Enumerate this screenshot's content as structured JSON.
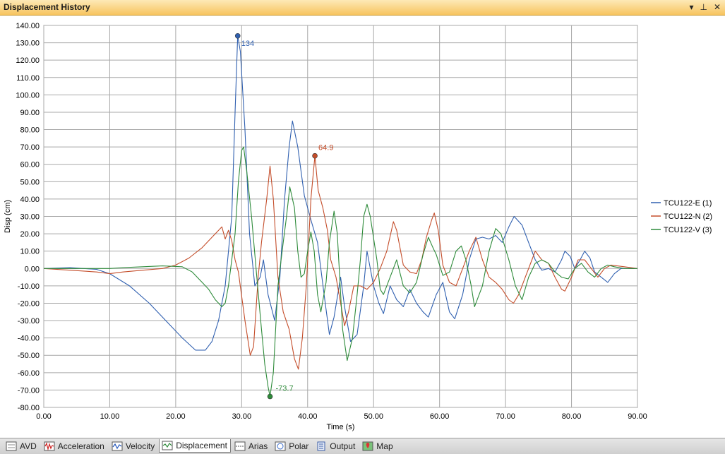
{
  "window": {
    "title": "Displacement History",
    "buttons": [
      "▾",
      "⊥",
      "✕"
    ]
  },
  "tabs": [
    {
      "label": "AVD",
      "icon": "avd-icon",
      "active": false
    },
    {
      "label": "Acceleration",
      "icon": "acceleration-icon",
      "active": false
    },
    {
      "label": "Velocity",
      "icon": "velocity-icon",
      "active": false
    },
    {
      "label": "Displacement",
      "icon": "displacement-icon",
      "active": true
    },
    {
      "label": "Arias",
      "icon": "arias-icon",
      "active": false
    },
    {
      "label": "Polar",
      "icon": "polar-icon",
      "active": false
    },
    {
      "label": "Output",
      "icon": "output-icon",
      "active": false
    },
    {
      "label": "Map",
      "icon": "map-icon",
      "active": false
    }
  ],
  "chart_data": {
    "type": "line",
    "title": "",
    "xlabel": "Time (s)",
    "ylabel": "Disp (cm)",
    "xlim": [
      0,
      90
    ],
    "ylim": [
      -80,
      140
    ],
    "xticks": [
      "0.00",
      "10.00",
      "20.00",
      "30.00",
      "40.00",
      "50.00",
      "60.00",
      "70.00",
      "80.00",
      "90.00"
    ],
    "yticks": [
      "140.00",
      "130.00",
      "120.00",
      "110.00",
      "100.00",
      "90.00",
      "80.00",
      "70.00",
      "60.00",
      "50.00",
      "40.00",
      "30.00",
      "20.00",
      "10.00",
      "0.00",
      "-10.00",
      "-20.00",
      "-30.00",
      "-40.00",
      "-50.00",
      "-60.00",
      "-70.00",
      "-80.00"
    ],
    "grid": true,
    "legend": "right",
    "series": [
      {
        "name": "TCU122-E (1)",
        "color": "#3060b0",
        "points": [
          [
            0,
            0
          ],
          [
            4,
            0.5
          ],
          [
            8,
            -0.5
          ],
          [
            10,
            -3
          ],
          [
            13,
            -10
          ],
          [
            16,
            -20
          ],
          [
            19,
            -32
          ],
          [
            21,
            -40
          ],
          [
            23,
            -47
          ],
          [
            24.5,
            -47
          ],
          [
            25.5,
            -42
          ],
          [
            26.5,
            -30
          ],
          [
            27.5,
            -10
          ],
          [
            28.5,
            30
          ],
          [
            29,
            90
          ],
          [
            29.4,
            134
          ],
          [
            29.8,
            125
          ],
          [
            30.5,
            80
          ],
          [
            31.2,
            20
          ],
          [
            32,
            -10
          ],
          [
            32.8,
            -5
          ],
          [
            33.3,
            5
          ],
          [
            34,
            -15
          ],
          [
            35,
            -30
          ],
          [
            35.8,
            -5
          ],
          [
            36.5,
            40
          ],
          [
            37.2,
            70
          ],
          [
            37.7,
            85
          ],
          [
            38.5,
            70
          ],
          [
            39.5,
            42
          ],
          [
            40.5,
            28
          ],
          [
            41.5,
            15
          ],
          [
            42.5,
            -15
          ],
          [
            43.3,
            -38
          ],
          [
            44,
            -28
          ],
          [
            45,
            -5
          ],
          [
            45.6,
            -22
          ],
          [
            46.5,
            -42
          ],
          [
            47.5,
            -38
          ],
          [
            48.5,
            -10
          ],
          [
            49,
            10
          ],
          [
            50,
            -10
          ],
          [
            50.8,
            -20
          ],
          [
            51.5,
            -26
          ],
          [
            52.5,
            -10
          ],
          [
            53.5,
            -18
          ],
          [
            54.5,
            -22
          ],
          [
            55.5,
            -12
          ],
          [
            56.5,
            -20
          ],
          [
            57.5,
            -25
          ],
          [
            58.3,
            -28
          ],
          [
            59.5,
            -15
          ],
          [
            60.5,
            -8
          ],
          [
            61.5,
            -25
          ],
          [
            62.3,
            -29
          ],
          [
            63.5,
            -15
          ],
          [
            64.5,
            5
          ],
          [
            65.5,
            17
          ],
          [
            66.5,
            18
          ],
          [
            67.5,
            17
          ],
          [
            68.5,
            19
          ],
          [
            69.5,
            15
          ],
          [
            70.5,
            24
          ],
          [
            71.3,
            30
          ],
          [
            72.5,
            25
          ],
          [
            73.5,
            15
          ],
          [
            74.5,
            5
          ],
          [
            75.5,
            -1
          ],
          [
            76.5,
            0
          ],
          [
            77.5,
            -2
          ],
          [
            78.5,
            5
          ],
          [
            79,
            10
          ],
          [
            79.8,
            7
          ],
          [
            80.5,
            0
          ],
          [
            81.3,
            5
          ],
          [
            82,
            10
          ],
          [
            82.8,
            6
          ],
          [
            83.5,
            -2
          ],
          [
            84.5,
            -5
          ],
          [
            85.5,
            -8
          ],
          [
            86.5,
            -3
          ],
          [
            87.5,
            0
          ],
          [
            88.5,
            0
          ],
          [
            90,
            0
          ]
        ]
      },
      {
        "name": "TCU122-N (2)",
        "color": "#c44d2a",
        "points": [
          [
            0,
            0
          ],
          [
            4,
            -1
          ],
          [
            8,
            -2
          ],
          [
            10,
            -3
          ],
          [
            12,
            -2
          ],
          [
            15,
            -1
          ],
          [
            18,
            0
          ],
          [
            20,
            2
          ],
          [
            22,
            6
          ],
          [
            24,
            12
          ],
          [
            25.5,
            18
          ],
          [
            26.5,
            22
          ],
          [
            27,
            24
          ],
          [
            27.5,
            17
          ],
          [
            28,
            22
          ],
          [
            28.5,
            16
          ],
          [
            29,
            5
          ],
          [
            29.5,
            -2
          ],
          [
            30.5,
            -30
          ],
          [
            31.3,
            -50
          ],
          [
            31.8,
            -45
          ],
          [
            32.5,
            -5
          ],
          [
            33,
            15
          ],
          [
            33.8,
            40
          ],
          [
            34.3,
            59
          ],
          [
            34.8,
            40
          ],
          [
            35.5,
            -5
          ],
          [
            36.3,
            -25
          ],
          [
            37.2,
            -35
          ],
          [
            38,
            -52
          ],
          [
            38.6,
            -58
          ],
          [
            39.2,
            -40
          ],
          [
            39.8,
            -10
          ],
          [
            40.5,
            40
          ],
          [
            41.1,
            64.9
          ],
          [
            41.6,
            45
          ],
          [
            42.3,
            35
          ],
          [
            43,
            22
          ],
          [
            43.5,
            5
          ],
          [
            44.3,
            -5
          ],
          [
            45,
            -20
          ],
          [
            45.6,
            -33
          ],
          [
            46.2,
            -25
          ],
          [
            47,
            -10
          ],
          [
            48,
            -10
          ],
          [
            49,
            -12
          ],
          [
            50,
            -8
          ],
          [
            51,
            0
          ],
          [
            52,
            10
          ],
          [
            53,
            27
          ],
          [
            53.5,
            22
          ],
          [
            54.5,
            2
          ],
          [
            55.5,
            -2
          ],
          [
            56.5,
            -3
          ],
          [
            57.3,
            5
          ],
          [
            58,
            18
          ],
          [
            58.8,
            28
          ],
          [
            59.2,
            32
          ],
          [
            59.8,
            22
          ],
          [
            60.5,
            2
          ],
          [
            61.5,
            -8
          ],
          [
            62.5,
            -10
          ],
          [
            63.5,
            0
          ],
          [
            64.5,
            10
          ],
          [
            65.5,
            18
          ],
          [
            66.5,
            5
          ],
          [
            67.5,
            -5
          ],
          [
            68.5,
            -8
          ],
          [
            69.5,
            -12
          ],
          [
            70.5,
            -18
          ],
          [
            71.2,
            -20
          ],
          [
            72,
            -15
          ],
          [
            73,
            -5
          ],
          [
            74,
            5
          ],
          [
            74.5,
            10
          ],
          [
            75.5,
            5
          ],
          [
            76.5,
            3
          ],
          [
            77.5,
            -5
          ],
          [
            78.5,
            -12
          ],
          [
            79,
            -13
          ],
          [
            80,
            -5
          ],
          [
            81,
            5
          ],
          [
            82,
            5
          ],
          [
            83,
            0
          ],
          [
            84,
            -5
          ],
          [
            85,
            0
          ],
          [
            86,
            2
          ],
          [
            88,
            1
          ],
          [
            90,
            0
          ]
        ]
      },
      {
        "name": "TCU122-V (3)",
        "color": "#2e8b3a",
        "points": [
          [
            0,
            0
          ],
          [
            4,
            0
          ],
          [
            8,
            0
          ],
          [
            10,
            0
          ],
          [
            12,
            0.5
          ],
          [
            15,
            1
          ],
          [
            18,
            1.5
          ],
          [
            21,
            1
          ],
          [
            22.5,
            -2
          ],
          [
            24,
            -8
          ],
          [
            25,
            -12
          ],
          [
            26,
            -18
          ],
          [
            27,
            -22
          ],
          [
            27.5,
            -20
          ],
          [
            28,
            -10
          ],
          [
            28.5,
            5
          ],
          [
            29,
            20
          ],
          [
            29.5,
            50
          ],
          [
            30,
            68
          ],
          [
            30.3,
            70
          ],
          [
            30.8,
            55
          ],
          [
            31.5,
            30
          ],
          [
            32.3,
            -5
          ],
          [
            33,
            -35
          ],
          [
            33.5,
            -55
          ],
          [
            34,
            -68
          ],
          [
            34.3,
            -73.7
          ],
          [
            34.8,
            -60
          ],
          [
            35.5,
            -10
          ],
          [
            36.3,
            15
          ],
          [
            36.8,
            30
          ],
          [
            37.3,
            47
          ],
          [
            38,
            35
          ],
          [
            38.5,
            10
          ],
          [
            39,
            -5
          ],
          [
            39.5,
            -3
          ],
          [
            40,
            10
          ],
          [
            40.5,
            21
          ],
          [
            41,
            10
          ],
          [
            41.5,
            -15
          ],
          [
            42,
            -25
          ],
          [
            42.8,
            -8
          ],
          [
            43.3,
            15
          ],
          [
            44,
            33
          ],
          [
            44.5,
            20
          ],
          [
            45.3,
            -35
          ],
          [
            46,
            -53
          ],
          [
            46.8,
            -40
          ],
          [
            47.5,
            -15
          ],
          [
            48,
            5
          ],
          [
            48.5,
            30
          ],
          [
            49,
            37
          ],
          [
            49.5,
            30
          ],
          [
            50.5,
            5
          ],
          [
            51,
            -12
          ],
          [
            51.5,
            -15
          ],
          [
            52.5,
            -5
          ],
          [
            53.5,
            5
          ],
          [
            54.5,
            -10
          ],
          [
            55.5,
            -14
          ],
          [
            56.5,
            -8
          ],
          [
            57.5,
            8
          ],
          [
            58.3,
            18
          ],
          [
            59,
            12
          ],
          [
            59.5,
            8
          ],
          [
            60.5,
            -4
          ],
          [
            61.5,
            -2
          ],
          [
            62.5,
            10
          ],
          [
            63.3,
            13
          ],
          [
            64,
            5
          ],
          [
            64.8,
            -10
          ],
          [
            65.3,
            -22
          ],
          [
            66.5,
            -10
          ],
          [
            67.5,
            10
          ],
          [
            68.5,
            23
          ],
          [
            69.3,
            20
          ],
          [
            70.5,
            5
          ],
          [
            71.5,
            -10
          ],
          [
            72.5,
            -18
          ],
          [
            73.5,
            -5
          ],
          [
            74.5,
            3
          ],
          [
            75.5,
            5
          ],
          [
            76.5,
            3
          ],
          [
            77.5,
            -2
          ],
          [
            78.5,
            -5
          ],
          [
            79.5,
            -6
          ],
          [
            80.5,
            0
          ],
          [
            81.5,
            3
          ],
          [
            82.5,
            -2
          ],
          [
            83.5,
            -5
          ],
          [
            84.5,
            0
          ],
          [
            85.5,
            2
          ],
          [
            86.5,
            1
          ],
          [
            88,
            0
          ],
          [
            90,
            0
          ]
        ]
      }
    ],
    "annotations": [
      {
        "series": "TCU122-E (1)",
        "x": 29.4,
        "y": 134,
        "text": "134"
      },
      {
        "series": "TCU122-N (2)",
        "x": 41.1,
        "y": 64.9,
        "text": "64.9"
      },
      {
        "series": "TCU122-V (3)",
        "x": 34.3,
        "y": -73.7,
        "text": "-73.7"
      }
    ]
  }
}
